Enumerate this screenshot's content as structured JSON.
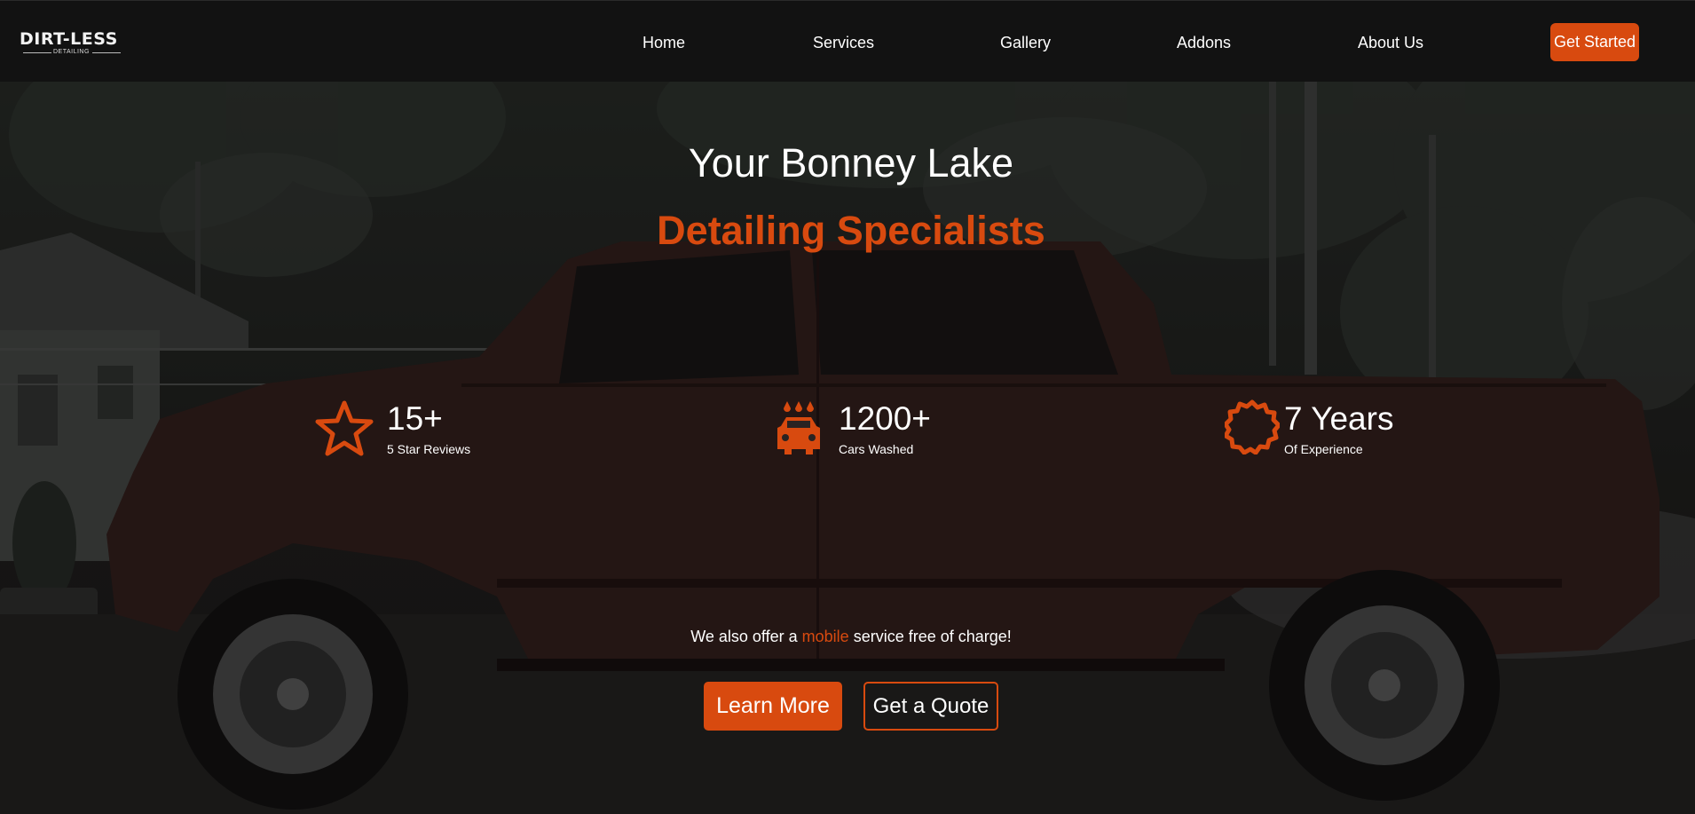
{
  "brand": {
    "name": "DIRT-LESS",
    "tagline": "DETAILING"
  },
  "nav": {
    "items": [
      {
        "label": "Home"
      },
      {
        "label": "Services"
      },
      {
        "label": "Gallery"
      },
      {
        "label": "Addons"
      },
      {
        "label": "About Us"
      }
    ],
    "cta_label": "Get Started"
  },
  "hero": {
    "title": "Your Bonney Lake",
    "subtitle": "Detailing Specialists",
    "stats": [
      {
        "icon": "star-icon",
        "value": "15+",
        "label": "5 Star Reviews"
      },
      {
        "icon": "car-wash-icon",
        "value": "1200+",
        "label": "Cars Washed"
      },
      {
        "icon": "badge-icon",
        "value": "7 Years",
        "label": "Of Experience"
      }
    ],
    "mobile_note": {
      "before": "We also offer a",
      "highlight": "mobile",
      "after": "service free of charge!"
    },
    "buttons": {
      "learn_more": "Learn More",
      "get_quote": "Get a Quote"
    }
  },
  "colors": {
    "accent": "#d84a0f",
    "header_bg": "#121212",
    "text": "#ffffff"
  }
}
